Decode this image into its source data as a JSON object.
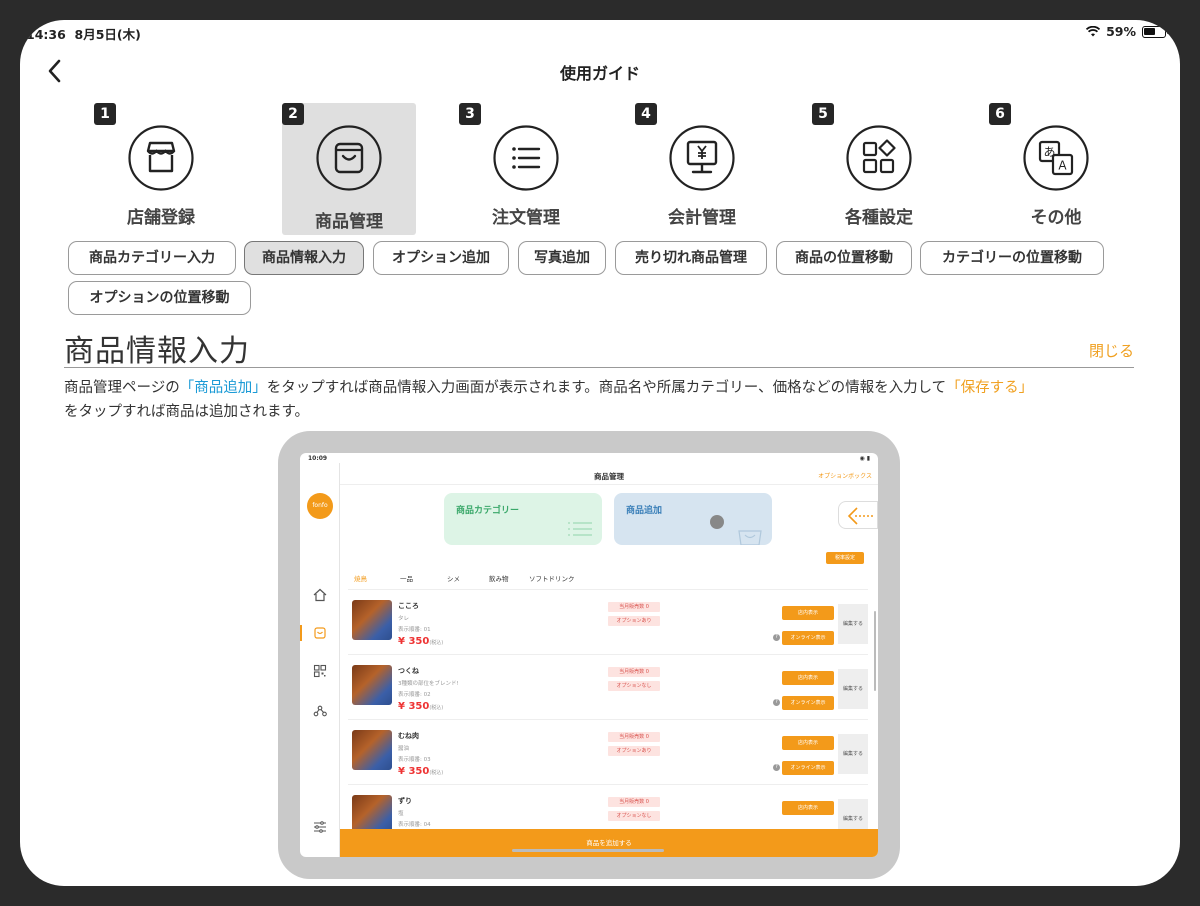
{
  "status": {
    "time": "14:36",
    "date": "8月5日(木)",
    "battery": "59%"
  },
  "nav": {
    "title": "使用ガイド"
  },
  "categories": [
    {
      "num": "1",
      "label": "店舗登録",
      "icon": "store-icon"
    },
    {
      "num": "2",
      "label": "商品管理",
      "icon": "bag-icon",
      "active": true
    },
    {
      "num": "3",
      "label": "注文管理",
      "icon": "list-icon"
    },
    {
      "num": "4",
      "label": "会計管理",
      "icon": "register-icon"
    },
    {
      "num": "5",
      "label": "各種設定",
      "icon": "apps-icon"
    },
    {
      "num": "6",
      "label": "その他",
      "icon": "translate-icon"
    }
  ],
  "chips": [
    "商品カテゴリー入力",
    "商品情報入力",
    "オプション追加",
    "写真追加",
    "売り切れ商品管理",
    "商品の位置移動",
    "カテゴリーの位置移動",
    "オプションの位置移動"
  ],
  "section": {
    "title": "商品情報入力",
    "close": "閉じる",
    "desc": {
      "p1": "商品管理ページの",
      "link1": "「商品追加」",
      "p2": "をタップすれば商品情報入力画面が表示されます。商品名や所属カテゴリー、価格などの情報を入力して",
      "link2": "「保存する」",
      "p3": "をタップすれば商品は追加されます。"
    }
  },
  "tablet": {
    "time": "10:09",
    "title": "商品管理",
    "option_box": "オプションボックス",
    "logo": "fonfo",
    "card_category": "商品カテゴリー",
    "card_add": "商品追加",
    "tax_button": "税率設定",
    "tabs": [
      "焼鳥",
      "一品",
      "シメ",
      "飲み物",
      "ソフトドリンク"
    ],
    "items": [
      {
        "name": "こころ",
        "sub": "タレ",
        "order": "表示順番: 01",
        "price": "¥ 350",
        "tax": "(税込)",
        "sold": "当月販売数 0",
        "option": "オプションあり"
      },
      {
        "name": "つくね",
        "sub": "3種類の部位をブレンド!",
        "order": "表示順番: 02",
        "price": "¥ 350",
        "tax": "(税込)",
        "sold": "当月販売数 0",
        "option": "オプションなし"
      },
      {
        "name": "むね肉",
        "sub": "醤油",
        "order": "表示順番: 03",
        "price": "¥ 350",
        "tax": "(税込)",
        "sold": "当月販売数 0",
        "option": "オプションあり"
      },
      {
        "name": "ずり",
        "sub": "塩",
        "order": "表示順番: 04",
        "price": "",
        "tax": "",
        "sold": "当月販売数 0",
        "option": "オプションなし"
      }
    ],
    "store_display": "店内表示",
    "online_display": "オンライン表示",
    "edit": "編集する",
    "add_product": "商品を追加する"
  }
}
